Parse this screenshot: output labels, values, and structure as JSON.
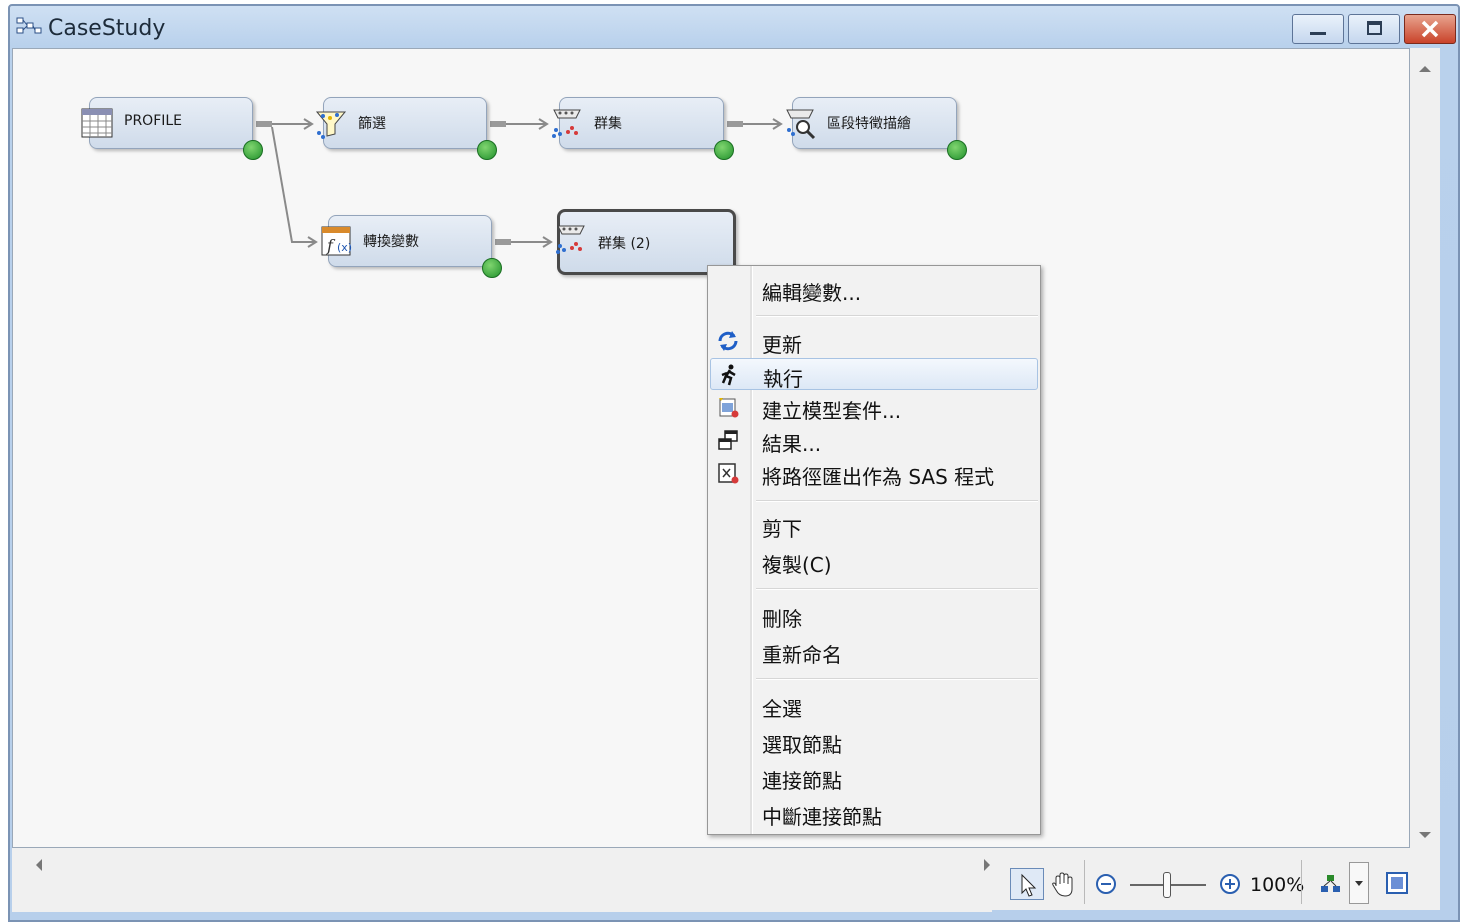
{
  "window": {
    "title": "CaseStudy"
  },
  "nodes": [
    {
      "id": "profile",
      "label": "PROFILE",
      "icon": "data-source-icon"
    },
    {
      "id": "filter",
      "label": "篩選",
      "icon": "filter-icon"
    },
    {
      "id": "cluster",
      "label": "群集",
      "icon": "cluster-icon"
    },
    {
      "id": "segment",
      "label": "區段特徵描繪",
      "icon": "segment-profile-icon"
    },
    {
      "id": "transform",
      "label": "轉換變數",
      "icon": "transform-icon"
    },
    {
      "id": "cluster2",
      "label": "群集 (2)",
      "icon": "cluster-icon"
    }
  ],
  "context_menu": {
    "items": [
      {
        "label": "編輯變數...",
        "icon": ""
      },
      {
        "label": "更新",
        "icon": "refresh-icon"
      },
      {
        "label": "執行",
        "icon": "run-icon",
        "highlighted": true
      },
      {
        "label": "建立模型套件...",
        "icon": "model-package-icon"
      },
      {
        "label": "結果...",
        "icon": "results-icon"
      },
      {
        "label": "將路徑匯出作為 SAS 程式",
        "icon": "export-sas-icon"
      },
      {
        "label": "剪下",
        "icon": ""
      },
      {
        "label": "複製(C)",
        "icon": ""
      },
      {
        "label": "刪除",
        "icon": ""
      },
      {
        "label": "重新命名",
        "icon": ""
      },
      {
        "label": "全選",
        "icon": ""
      },
      {
        "label": "選取節點",
        "icon": ""
      },
      {
        "label": "連接節點",
        "icon": ""
      },
      {
        "label": "中斷連接節點",
        "icon": ""
      }
    ]
  },
  "toolbar": {
    "zoom": "100%",
    "zoom_level_percent": 100
  }
}
